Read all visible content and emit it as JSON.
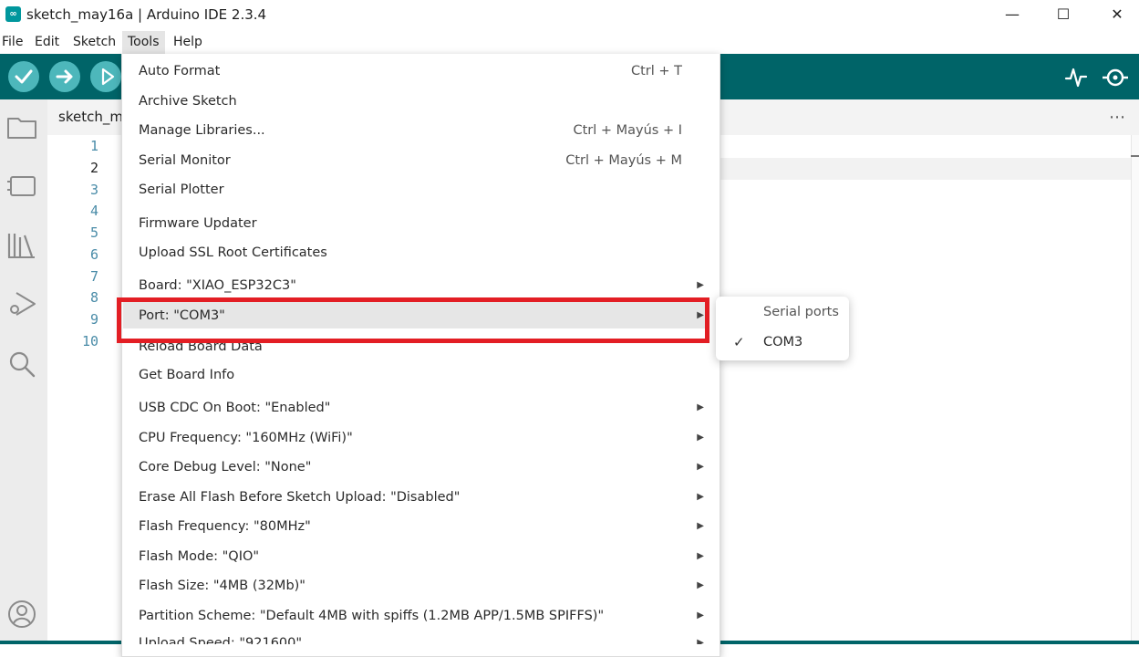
{
  "window": {
    "title": "sketch_may16a | Arduino IDE 2.3.4",
    "minimize": "—",
    "maximize": "☐",
    "close": "✕"
  },
  "menubar": {
    "items": [
      "File",
      "Edit",
      "Sketch",
      "Tools",
      "Help"
    ],
    "active": "Tools"
  },
  "editor": {
    "tab_label": "sketch_m",
    "line_numbers": [
      "1",
      "2",
      "3",
      "4",
      "5",
      "6",
      "7",
      "8",
      "9",
      "10"
    ],
    "current_line": "2"
  },
  "tools_menu": {
    "items": [
      {
        "label": "Auto Format",
        "shortcut": "Ctrl + T",
        "submenu": false
      },
      {
        "label": "Archive Sketch",
        "shortcut": "",
        "submenu": false
      },
      {
        "label": "Manage Libraries...",
        "shortcut": "Ctrl + Mayús + I",
        "submenu": false
      },
      {
        "label": "Serial Monitor",
        "shortcut": "Ctrl + Mayús + M",
        "submenu": false
      },
      {
        "label": "Serial Plotter",
        "shortcut": "",
        "submenu": false
      },
      {
        "label": "Firmware Updater",
        "shortcut": "",
        "submenu": false
      },
      {
        "label": "Upload SSL Root Certificates",
        "shortcut": "",
        "submenu": false
      },
      {
        "label": "Board: \"XIAO_ESP32C3\"",
        "shortcut": "",
        "submenu": true
      },
      {
        "label": "Port: \"COM3\"",
        "shortcut": "",
        "submenu": true,
        "highlighted": true
      },
      {
        "label": "Reload Board Data",
        "shortcut": "",
        "submenu": false
      },
      {
        "label": "Get Board Info",
        "shortcut": "",
        "submenu": false
      },
      {
        "label": "USB CDC On Boot: \"Enabled\"",
        "shortcut": "",
        "submenu": true
      },
      {
        "label": "CPU Frequency: \"160MHz (WiFi)\"",
        "shortcut": "",
        "submenu": true
      },
      {
        "label": "Core Debug Level: \"None\"",
        "shortcut": "",
        "submenu": true
      },
      {
        "label": "Erase All Flash Before Sketch Upload: \"Disabled\"",
        "shortcut": "",
        "submenu": true
      },
      {
        "label": "Flash Frequency: \"80MHz\"",
        "shortcut": "",
        "submenu": true
      },
      {
        "label": "Flash Mode: \"QIO\"",
        "shortcut": "",
        "submenu": true
      },
      {
        "label": "Flash Size: \"4MB (32Mb)\"",
        "shortcut": "",
        "submenu": true
      },
      {
        "label": "Partition Scheme: \"Default 4MB with spiffs (1.2MB APP/1.5MB SPIFFS)\"",
        "shortcut": "",
        "submenu": true
      },
      {
        "label": "Upload Speed: \"921600\"",
        "shortcut": "",
        "submenu": true
      }
    ]
  },
  "port_submenu": {
    "header": "Serial ports",
    "items": [
      {
        "label": "COM3",
        "checked": true,
        "check_glyph": "✓"
      }
    ]
  },
  "icons": {
    "verify": "checkmark-icon",
    "upload": "arrow-right-icon",
    "debug": "debug-icon",
    "serial_plotter": "plotter-icon",
    "serial_monitor": "monitor-icon",
    "more": "⋯",
    "submenu_arrow": "▶"
  },
  "colors": {
    "toolbar": "#006468",
    "toolbar_button": "#4db7bb",
    "highlight_box": "#e31e24",
    "line_numbers": "#4a8ca8"
  }
}
